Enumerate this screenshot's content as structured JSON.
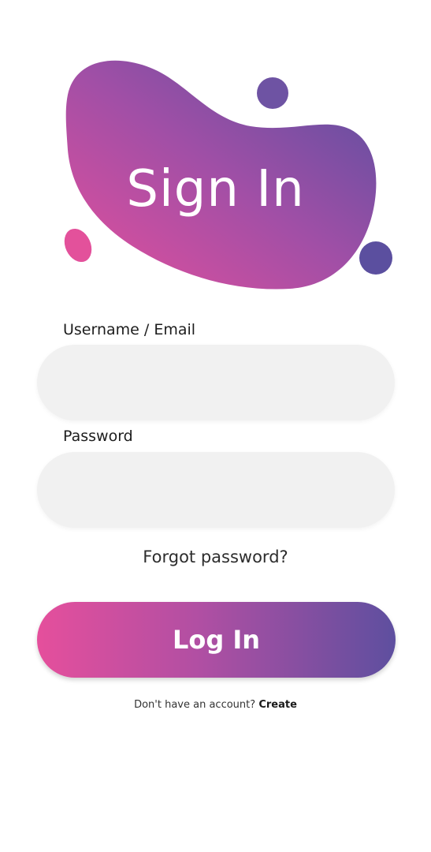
{
  "header": {
    "title": "Sign In"
  },
  "colors": {
    "gradient_start": "#e54f9c",
    "gradient_mid": "#b14fa3",
    "gradient_end": "#5e4f9f",
    "input_background": "#f1f1f1"
  },
  "form": {
    "username_label": "Username / Email",
    "username_value": "",
    "password_label": "Password",
    "password_value": "",
    "forgot_label": "Forgot password?",
    "login_label": "Log In"
  },
  "footer": {
    "prompt": "Don't have an account?",
    "create_label": "Create"
  }
}
